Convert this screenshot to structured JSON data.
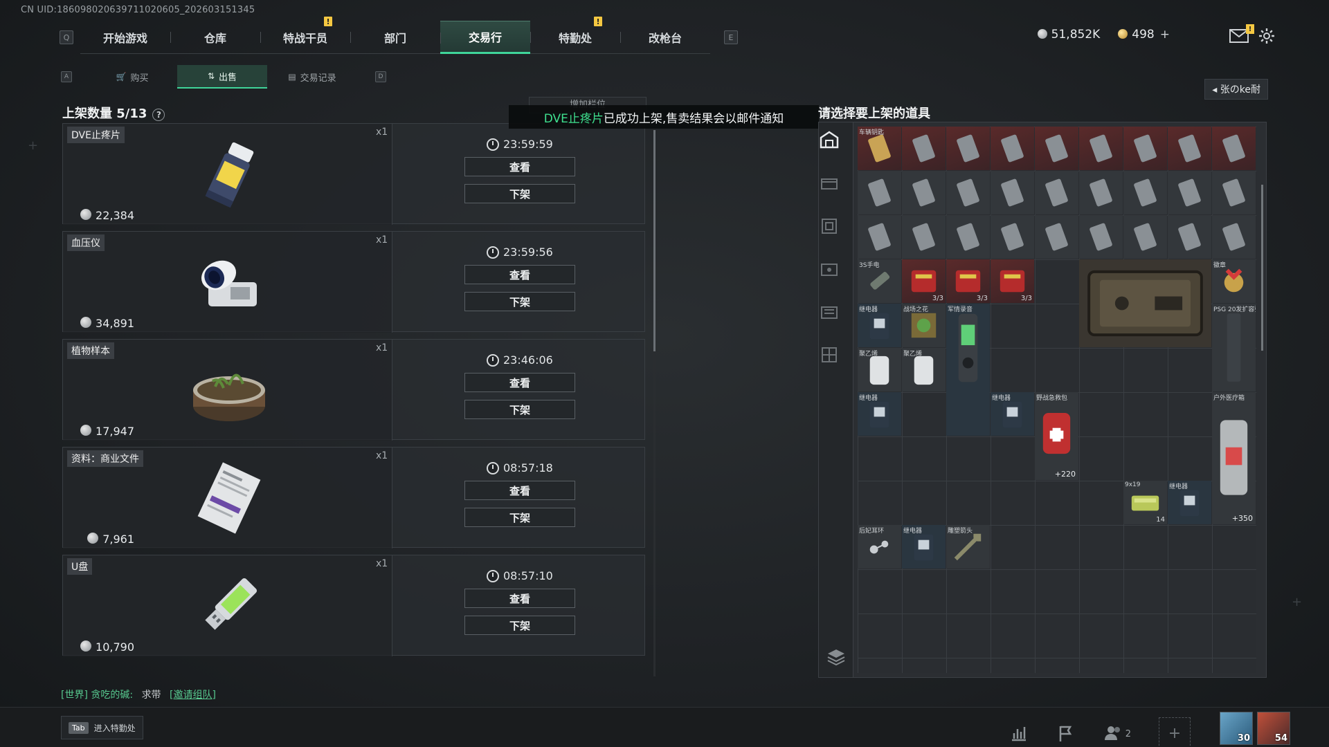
{
  "uid_text": "CN UID:186098020639711020605_202603151345",
  "nav": {
    "left_key": "Q",
    "right_key": "E",
    "tabs": [
      {
        "label": "开始游戏",
        "alert": false
      },
      {
        "label": "仓库",
        "alert": false
      },
      {
        "label": "特战干员",
        "alert": true
      },
      {
        "label": "部门",
        "alert": false
      },
      {
        "label": "交易行",
        "alert": false,
        "active": true
      },
      {
        "label": "特勤处",
        "alert": true
      },
      {
        "label": "改枪台",
        "alert": false
      }
    ],
    "alert_mark": "!"
  },
  "currency": {
    "silver": "51,852K",
    "gold": "498"
  },
  "subnav": {
    "left_key": "A",
    "right_key": "D",
    "tabs": [
      {
        "label": "购买"
      },
      {
        "label": "出售",
        "active": true
      },
      {
        "label": "交易记录"
      }
    ]
  },
  "user_chip": "张のke耐",
  "listed": {
    "title": "上架数量 5/13",
    "help": "?",
    "view_label": "查看",
    "remove_label": "下架",
    "items": [
      {
        "name": "DVE止疼片",
        "qty": "x1",
        "timer": "23:59:59",
        "price": "22,384"
      },
      {
        "name": "血压仪",
        "qty": "x1",
        "timer": "23:59:56",
        "price": "34,891"
      },
      {
        "name": "植物样本",
        "qty": "x1",
        "timer": "23:46:06",
        "price": "17,947"
      },
      {
        "name": "资料：商业文件",
        "qty": "x1",
        "timer": "08:57:18",
        "price": "7,961"
      },
      {
        "name": "U盘",
        "qty": "x1",
        "timer": "08:57:10",
        "price": "10,790"
      }
    ]
  },
  "toast": {
    "ghost": "增加栏位",
    "highlight": "DVE止疼片",
    "message": "已成功上架,售卖结果会以邮件通知"
  },
  "inventory": {
    "title": "请选择要上架的道具",
    "slots": [
      {
        "label": "车辆钥匙",
        "style": "gray"
      },
      {
        "label": "3S手电",
        "style": "gray"
      },
      {
        "label": "3/3",
        "style": "red"
      },
      {
        "label": "3/3",
        "style": "red"
      },
      {
        "label": "3/3",
        "style": "red"
      },
      {
        "label": "徽章",
        "style": "gray"
      },
      {
        "label": "继电器",
        "style": "blue"
      },
      {
        "label": "战场之花",
        "style": "gray"
      },
      {
        "label": "军情录音",
        "style": "blue"
      },
      {
        "label": "PSG 20发扩容弹匣",
        "style": "gray"
      },
      {
        "label": "聚乙烯",
        "style": "gray"
      },
      {
        "label": "聚乙烯",
        "style": "gray"
      },
      {
        "label": "继电器",
        "style": "blue"
      },
      {
        "label": "继电器",
        "style": "blue"
      },
      {
        "label": "野战急救包",
        "style": "gray"
      },
      {
        "label": "户外医疗箱",
        "style": "gray"
      },
      {
        "label": "9x19",
        "style": "gray"
      },
      {
        "label": "继电器",
        "style": "blue"
      },
      {
        "label": "后妃耳环",
        "style": "gray"
      },
      {
        "label": "继电器",
        "style": "blue"
      },
      {
        "label": "雕塑箭头",
        "style": "gray"
      }
    ],
    "ammo_count": "14",
    "medkit_bonus": "+220",
    "outdoor_bonus": "+350"
  },
  "chat": {
    "channel": "[世界]",
    "user": "贪吃的碱:",
    "message": "求带",
    "link": "[邀请组队]"
  },
  "bottom": {
    "tab_key": "Tab",
    "tab_hint": "进入特勤处",
    "team_count": "2",
    "avatar1_level": "30",
    "avatar2_level": "54"
  }
}
